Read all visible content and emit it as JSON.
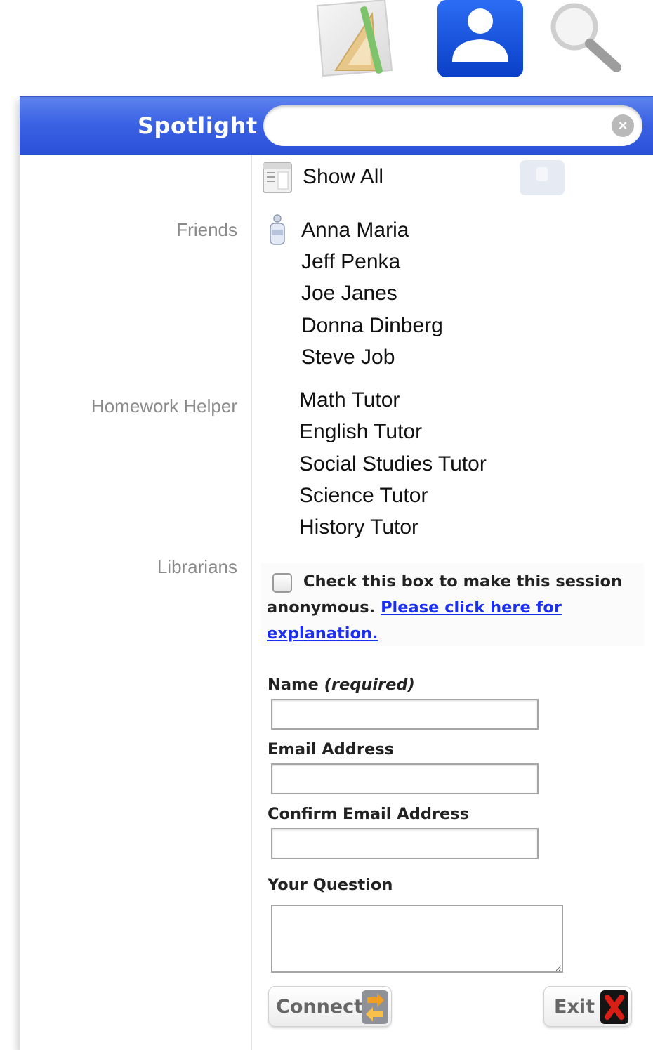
{
  "dock": {
    "icons": [
      "notes-drafting-icon",
      "person-icon",
      "magnifier-icon"
    ]
  },
  "spotlight": {
    "label": "Spotlight",
    "search_value": "",
    "show_all": "Show All"
  },
  "sections": {
    "friends": {
      "label": "Friends",
      "items": [
        "Anna Maria",
        "Jeff Penka",
        "Joe Janes",
        "Donna Dinberg",
        "Steve Job"
      ]
    },
    "homework": {
      "label": "Homework Helper",
      "items": [
        "Math Tutor",
        "English Tutor",
        "Social Studies Tutor",
        "Science Tutor",
        "History Tutor"
      ]
    },
    "librarians": {
      "label": "Librarians"
    }
  },
  "form": {
    "anon_checked": false,
    "anon_text": "Check this box to make this session anonymous.",
    "anon_link": "Please click here for explanation.",
    "name_label": "Name",
    "name_required": "(required)",
    "name_value": "",
    "email_label": "Email Address",
    "email_value": "",
    "confirm_label": "Confirm Email Address",
    "confirm_value": "",
    "question_label": "Your Question",
    "question_value": "",
    "connect_label": "Connect",
    "exit_label": "Exit"
  },
  "colors": {
    "spotlight_bar": "#3c63e4",
    "link": "#1b2ff0",
    "section_label": "#8a8a8a",
    "exit_red": "#d81f16",
    "connect_orange": "#f0a020"
  }
}
